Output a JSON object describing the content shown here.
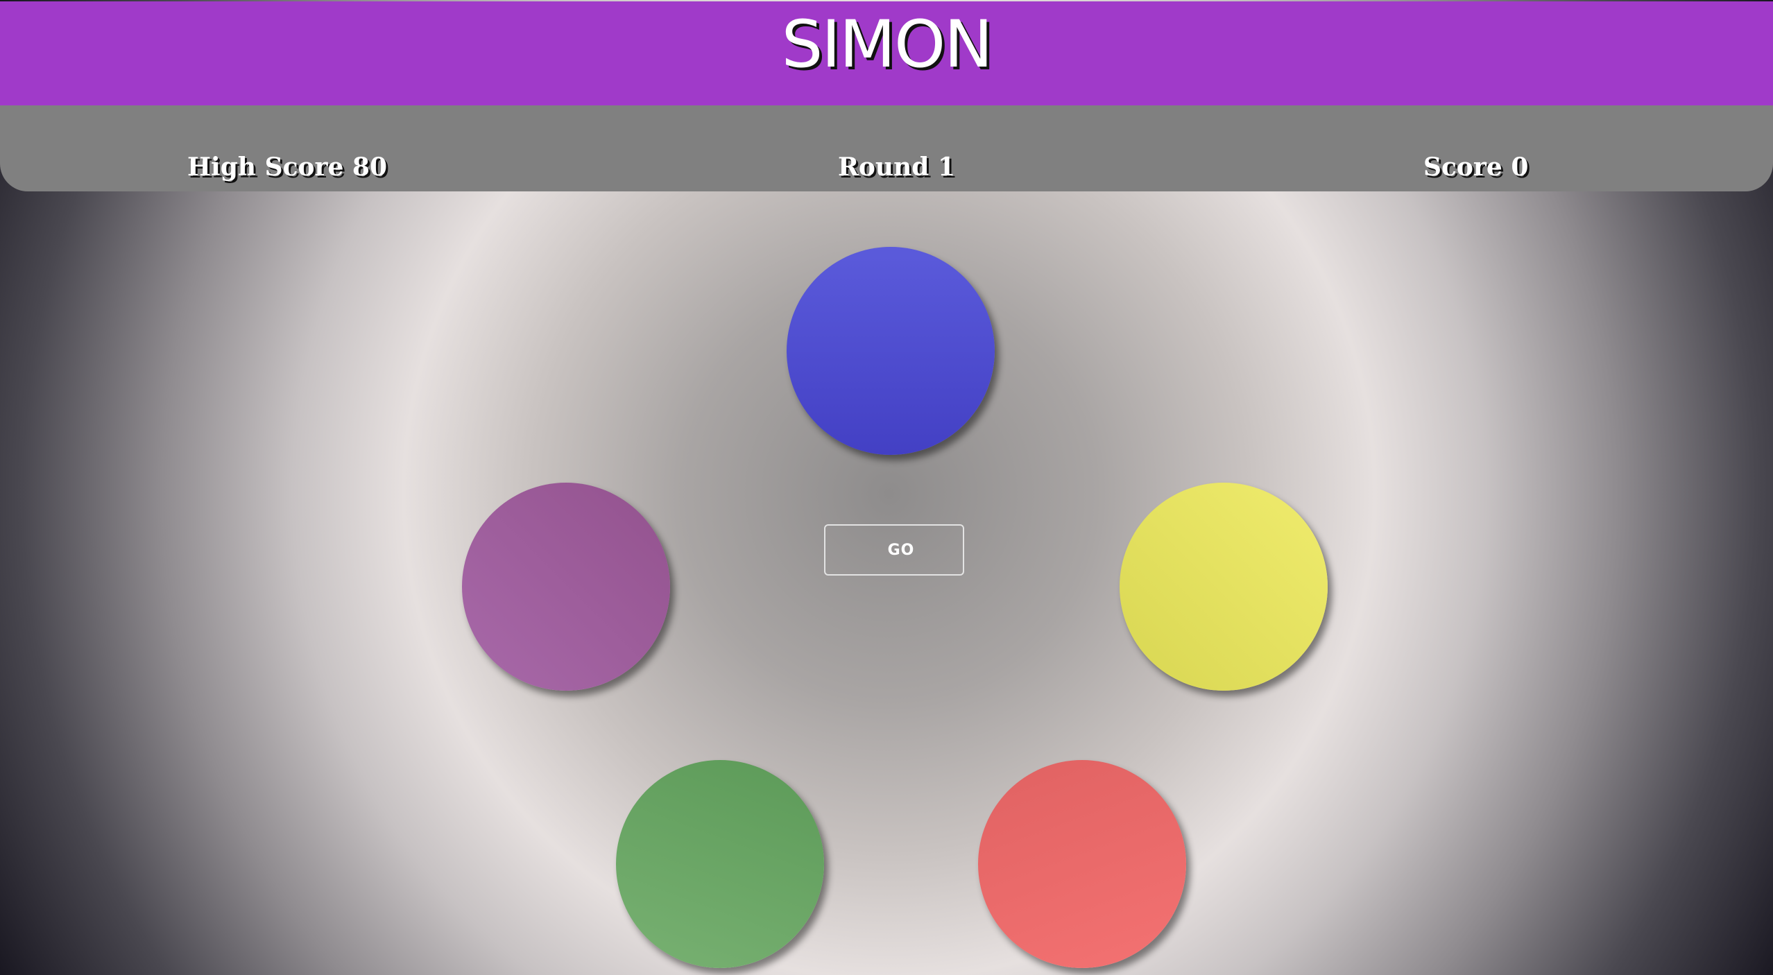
{
  "header": {
    "title": "SIMON",
    "accent_color": "#a03ac9"
  },
  "stats": {
    "high_score_label": "High Score 80",
    "round_label": "Round 1",
    "score_label": "Score 0"
  },
  "game": {
    "go_label": "GO",
    "pads": [
      {
        "name": "blue",
        "color": "#4f4fd0"
      },
      {
        "name": "purple",
        "color": "#9e5d9e"
      },
      {
        "name": "yellow",
        "color": "#e4e25e"
      },
      {
        "name": "green",
        "color": "#68a464"
      },
      {
        "name": "red",
        "color": "#ea6868"
      }
    ]
  }
}
